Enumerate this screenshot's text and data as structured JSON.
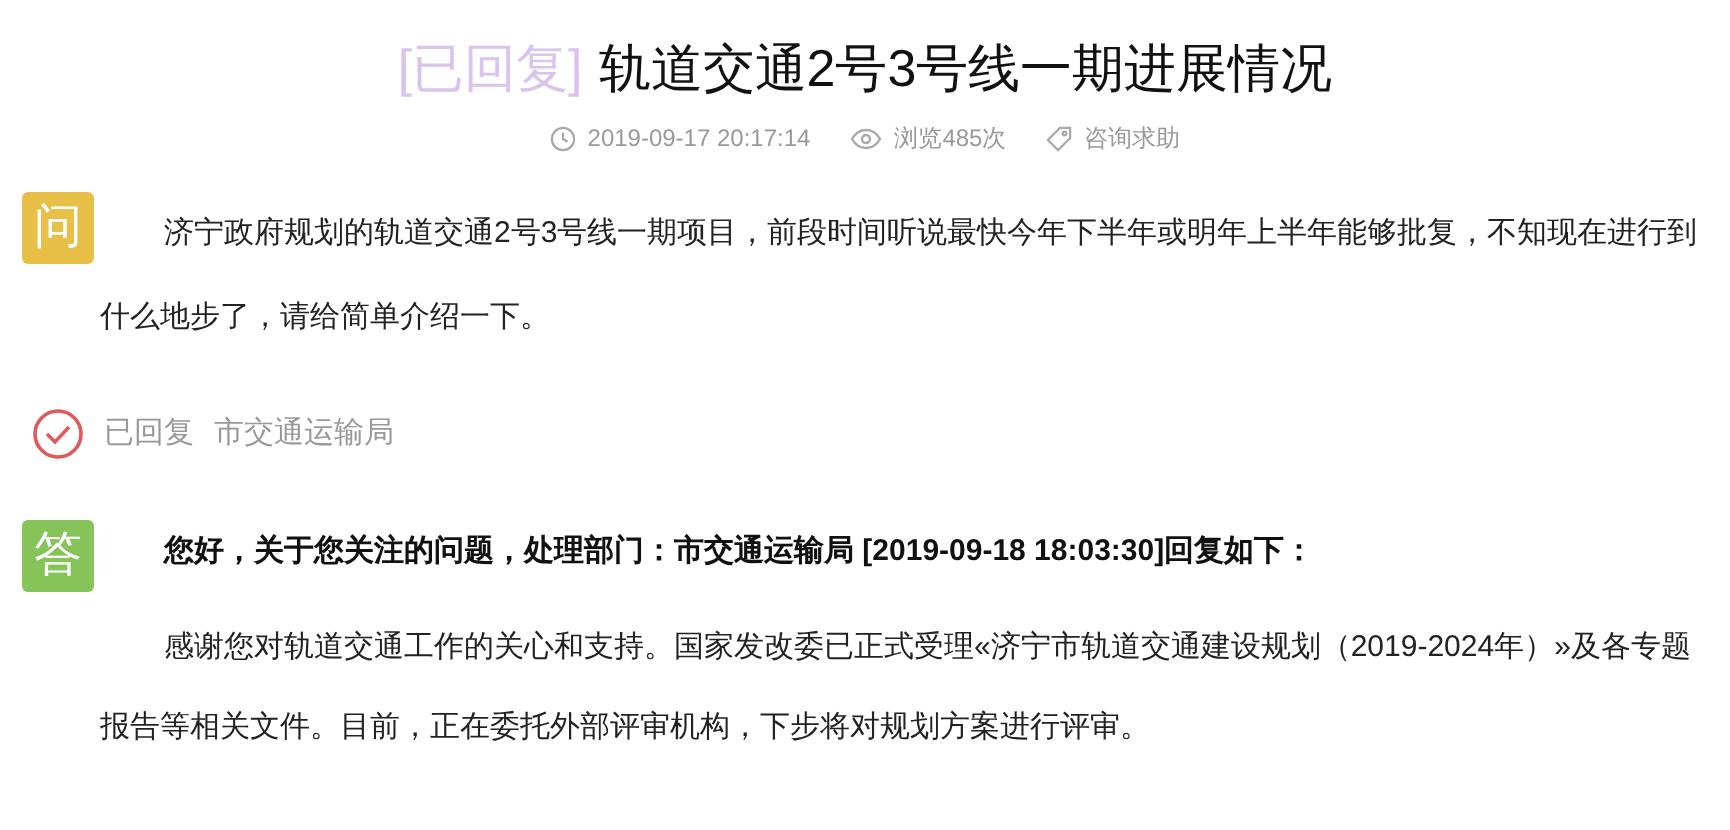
{
  "title": {
    "status": "[已回复]",
    "text": "轨道交通2号3号线一期进展情况"
  },
  "meta": {
    "time": "2019-09-17 20:17:14",
    "views": "浏览485次",
    "category": "咨询求助"
  },
  "question": {
    "badge": "问",
    "text": "济宁政府规划的轨道交通2号3号线一期项目，前段时间听说最快今年下半年或明年上半年能够批复，不知现在进行到什么地步了，请给简单介绍一下。"
  },
  "reply_status": {
    "label": "已回复",
    "department": "市交通运输局"
  },
  "answer": {
    "badge": "答",
    "heading": "您好，关于您关注的问题，处理部门：市交通运输局 [2019-09-18 18:03:30]回复如下：",
    "text": "感谢您对轨道交通工作的关心和支持。国家发改委已正式受理«济宁市轨道交通建设规划（2019-2024年）»及各专题报告等相关文件。目前，正在委托外部评审机构，下步将对规划方案进行评审。"
  }
}
